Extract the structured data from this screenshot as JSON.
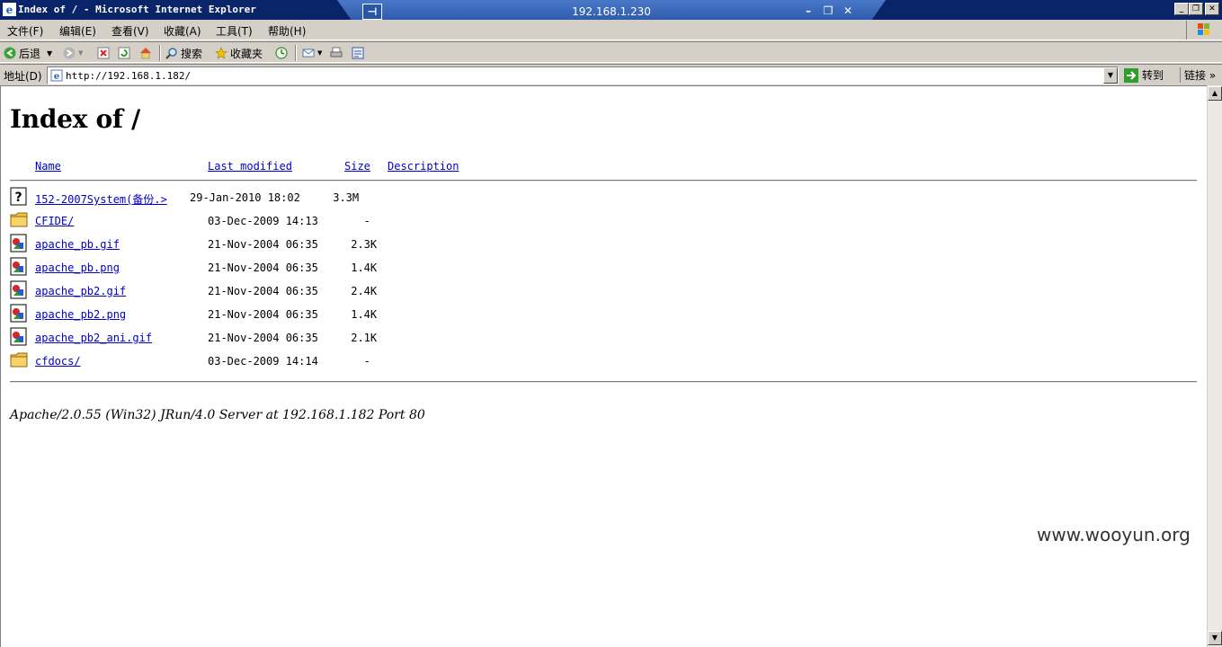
{
  "window": {
    "title": "Index of / - Microsoft Internet Explorer",
    "remote_host": "192.168.1.230"
  },
  "menu": [
    "文件(F)",
    "编辑(E)",
    "查看(V)",
    "收藏(A)",
    "工具(T)",
    "帮助(H)"
  ],
  "toolbar": {
    "back_label": "后退",
    "search_label": "搜索",
    "favorites_label": "收藏夹"
  },
  "address": {
    "label": "地址(D)",
    "url": "http://192.168.1.182/",
    "go_label": "转到",
    "links_label": "链接 »"
  },
  "page": {
    "heading": "Index of /",
    "columns": {
      "name": "Name",
      "modified": "Last modified",
      "size": "Size",
      "description": "Description"
    },
    "files": [
      {
        "name": "152-2007System(备份.>",
        "date": "29-Jan-2010 18:02",
        "size": " 3.3M",
        "icon": "unknown-file-icon"
      },
      {
        "name": "CFIDE/",
        "date": "03-Dec-2009 14:13",
        "size": "   -",
        "icon": "folder-icon"
      },
      {
        "name": "apache_pb.gif",
        "date": "21-Nov-2004 06:35",
        "size": " 2.3K",
        "icon": "image-file-icon"
      },
      {
        "name": "apache_pb.png",
        "date": "21-Nov-2004 06:35",
        "size": " 1.4K",
        "icon": "image-file-icon"
      },
      {
        "name": "apache_pb2.gif",
        "date": "21-Nov-2004 06:35",
        "size": " 2.4K",
        "icon": "image-file-icon"
      },
      {
        "name": "apache_pb2.png",
        "date": "21-Nov-2004 06:35",
        "size": " 1.4K",
        "icon": "image-file-icon"
      },
      {
        "name": "apache_pb2_ani.gif",
        "date": "21-Nov-2004 06:35",
        "size": " 2.1K",
        "icon": "image-file-icon"
      },
      {
        "name": "cfdocs/",
        "date": "03-Dec-2009 14:14",
        "size": "   -",
        "icon": "folder-icon"
      }
    ],
    "server_signature": "Apache/2.0.55 (Win32) JRun/4.0 Server at 192.168.1.182 Port 80"
  },
  "watermark": "www.wooyun.org",
  "colors": {
    "link": "#0000cc",
    "titlebar": "#0a246a",
    "chrome": "#d4d0c8"
  }
}
